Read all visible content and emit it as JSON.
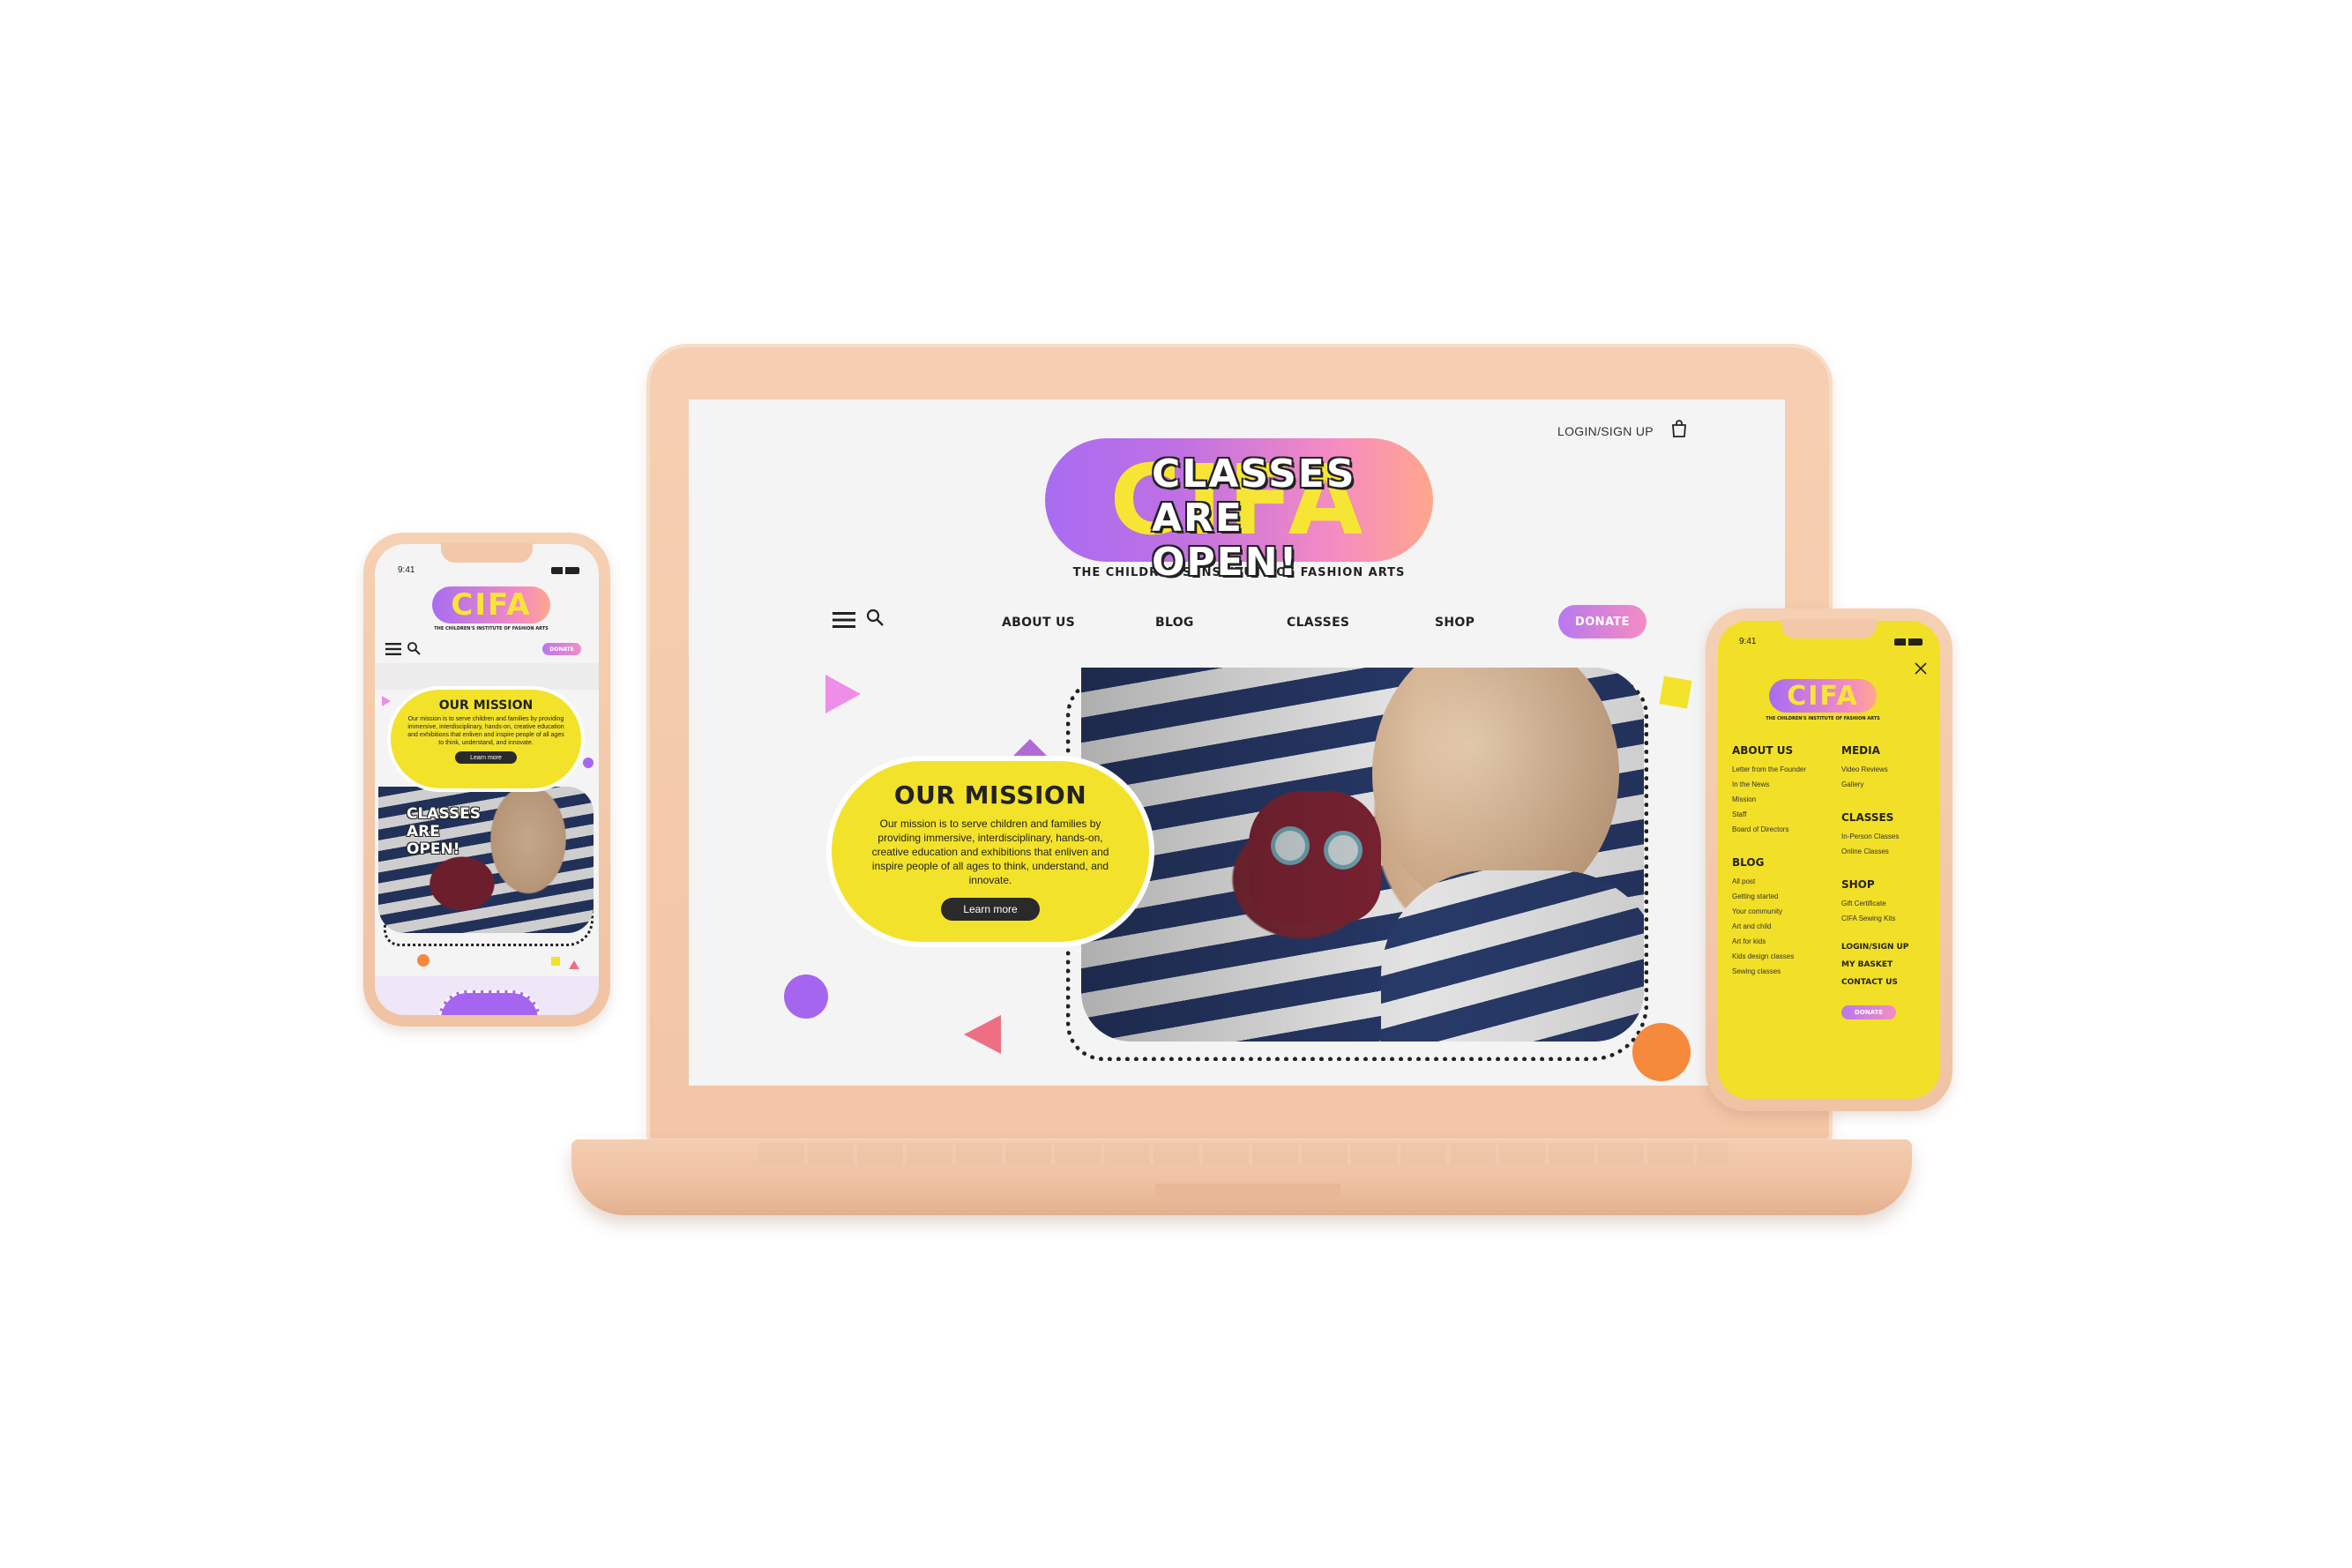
{
  "brand": {
    "logo": "CIFA",
    "tagline": "THE CHILDREN'S INSTITUTE OF FASHION ARTS"
  },
  "colors": {
    "device": "#f2c6a6",
    "accent_yellow": "#f3e22a",
    "accent_purple": "#a86cf2",
    "accent_pink": "#f58cc2",
    "accent_orange": "#f58a3c"
  },
  "icons": {
    "cart": "shopping-bag-icon",
    "menu": "hamburger-icon",
    "search": "search-icon",
    "close": "close-icon"
  },
  "desktop": {
    "login": "LOGIN/SIGN UP",
    "nav": [
      "ABOUT US",
      "BLOG",
      "CLASSES",
      "SHOP"
    ],
    "donate": "DONATE",
    "hero_title_lines": [
      "CLASSES",
      "ARE",
      "OPEN!"
    ],
    "mission": {
      "title": "OUR MISSION",
      "text": "Our mission is to serve children and families by providing immersive, interdisciplinary, hands-on, creative education and exhibitions that enliven and inspire people of all ages to think, understand, and innovate.",
      "button": "Learn more"
    }
  },
  "mobile_left": {
    "time": "9:41",
    "donate": "DONATE",
    "mission_title": "OUR MISSION",
    "mission_text": "Our mission is to serve children and families by providing immersive, interdisciplinary, hands-on, creative education and exhibitions that enliven and inspire people of all ages to think, understand, and innovate.",
    "mission_button": "Learn more",
    "hero_title_lines": [
      "CLASSES",
      "ARE",
      "OPEN!"
    ]
  },
  "mobile_right": {
    "time": "9:41",
    "about_title": "ABOUT US",
    "about_links": [
      "Letter from the Founder",
      "In the News",
      "Mission",
      "Staff",
      "Board of Directors"
    ],
    "media_title": "MEDIA",
    "media_links": [
      "Video Reviews",
      "Gallery"
    ],
    "blog_title": "BLOG",
    "blog_links": [
      "All post",
      "Getting started",
      "Your community",
      "Art and child",
      "Art for kids",
      "Kids design classes",
      "Sewing classes"
    ],
    "classes_title": "CLASSES",
    "classes_links": [
      "In-Person Classes",
      "Online Classes"
    ],
    "shop_title": "SHOP",
    "shop_links": [
      "Gift Certificate",
      "CIFA Sewing Kits"
    ],
    "account_links": [
      "LOGIN/SIGN UP",
      "MY BASKET",
      "CONTACT US"
    ],
    "donate": "DONATE"
  }
}
